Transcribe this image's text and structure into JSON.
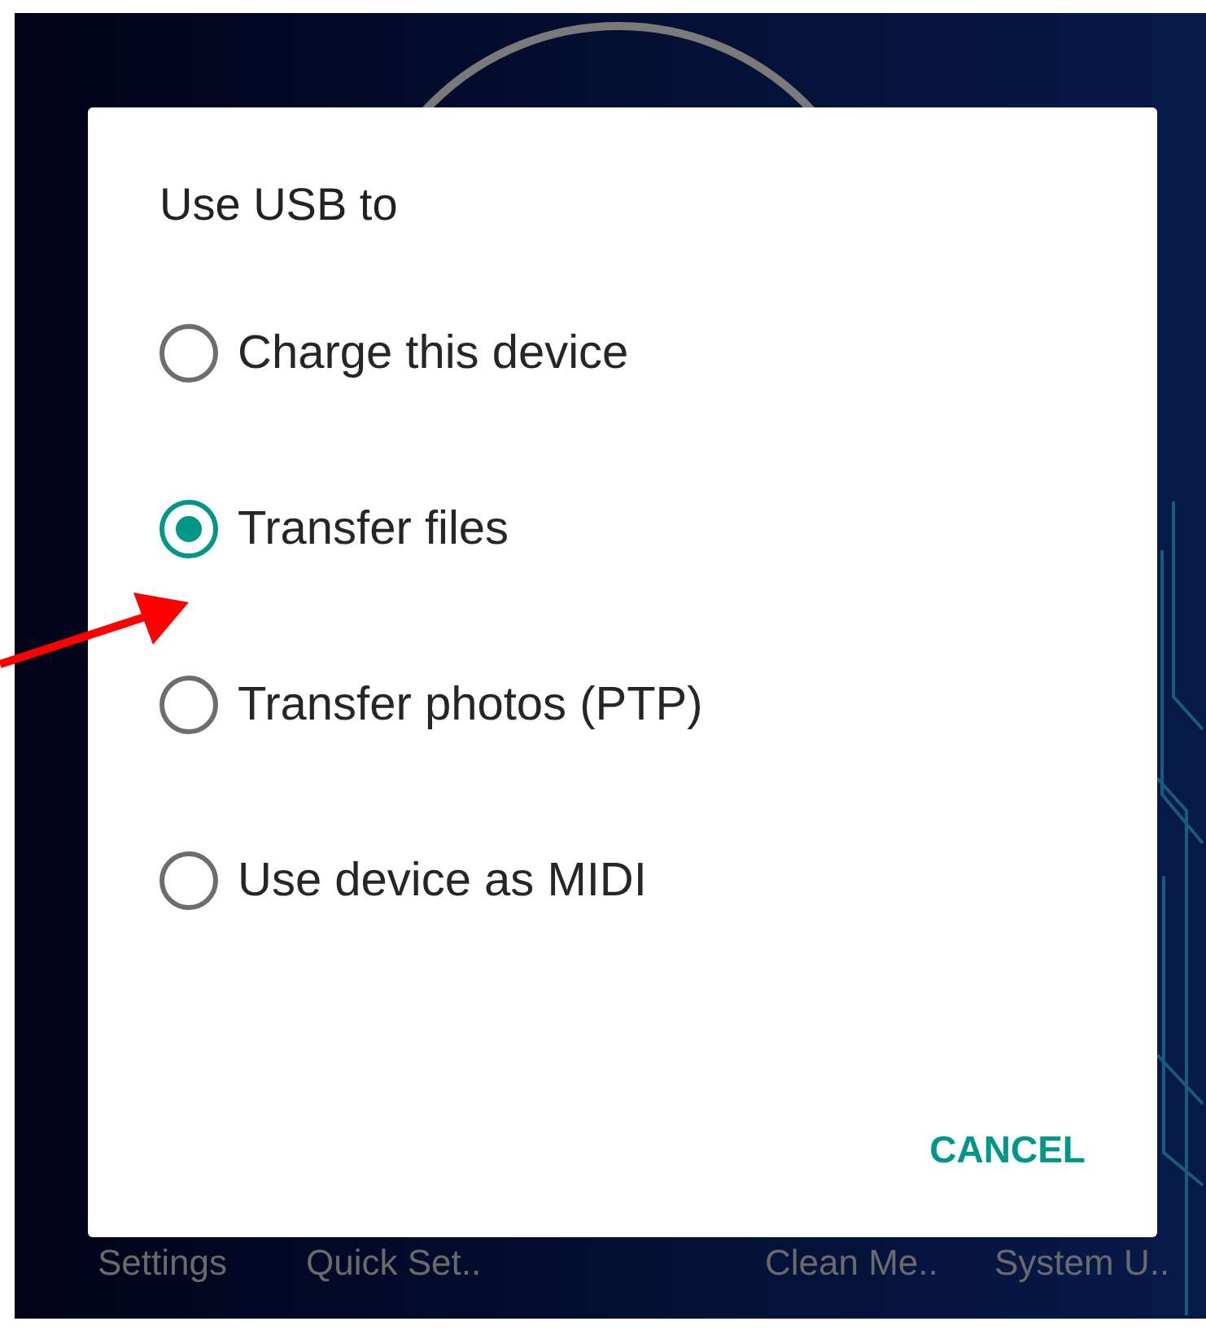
{
  "dialog": {
    "title": "Use USB to",
    "options": [
      {
        "label": "Charge this device",
        "selected": false
      },
      {
        "label": "Transfer files",
        "selected": true
      },
      {
        "label": "Transfer photos (PTP)",
        "selected": false
      },
      {
        "label": "Use device as MIDI",
        "selected": false
      }
    ],
    "cancel_button": "CANCEL"
  },
  "home_apps": [
    "Settings",
    "Quick Set..",
    "Clean Me..",
    "System U.."
  ]
}
